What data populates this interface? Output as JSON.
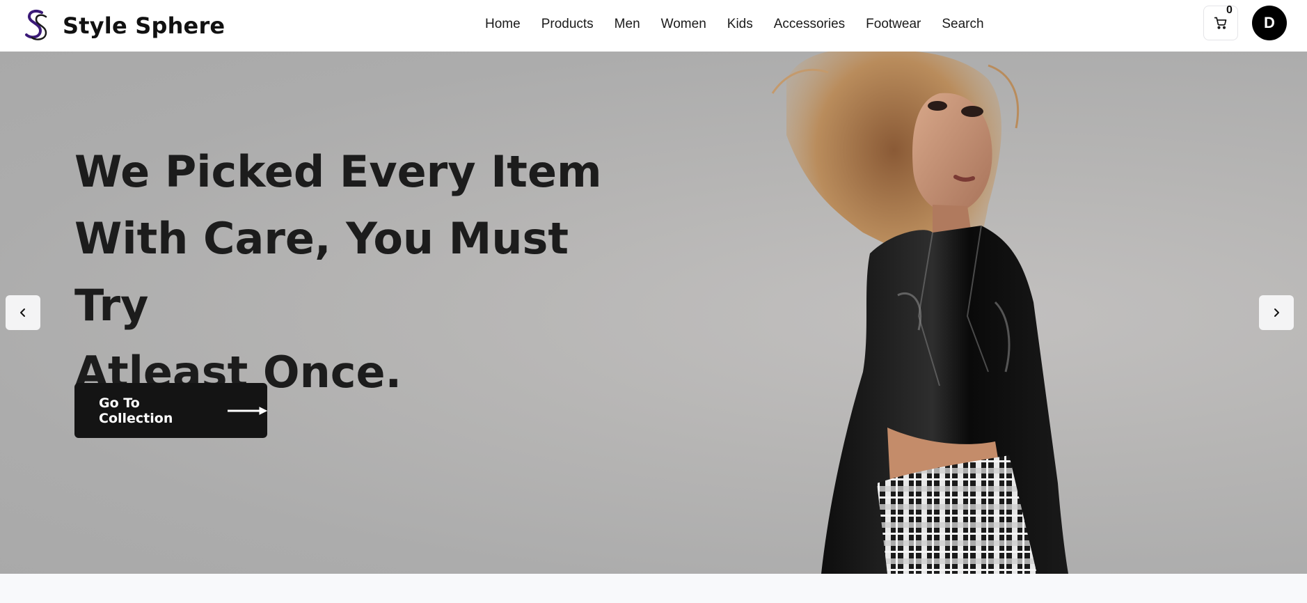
{
  "brand": {
    "name": "Style Sphere",
    "logo_icon": "ss-monogram-logo"
  },
  "nav": {
    "links": [
      "Home",
      "Products",
      "Men",
      "Women",
      "Kids",
      "Accessories",
      "Footwear",
      "Search"
    ]
  },
  "header_actions": {
    "cart_icon": "cart-icon",
    "cart_count": "0",
    "avatar_initial": "D"
  },
  "hero": {
    "headline_line1": "We Picked Every Item",
    "headline_line2_regular": "With Care, ",
    "headline_line2_bold": "You Must Try",
    "headline_line3": "Atleast Once.",
    "cta_label": "Go To Collection",
    "cta_icon": "arrow-right-icon",
    "prev_icon": "chevron-left-icon",
    "next_icon": "chevron-right-icon"
  },
  "colors": {
    "hero_background": "#acacac",
    "cta_background": "#141414",
    "avatar_background": "#000000",
    "logo_accent": "#3b1a78"
  }
}
